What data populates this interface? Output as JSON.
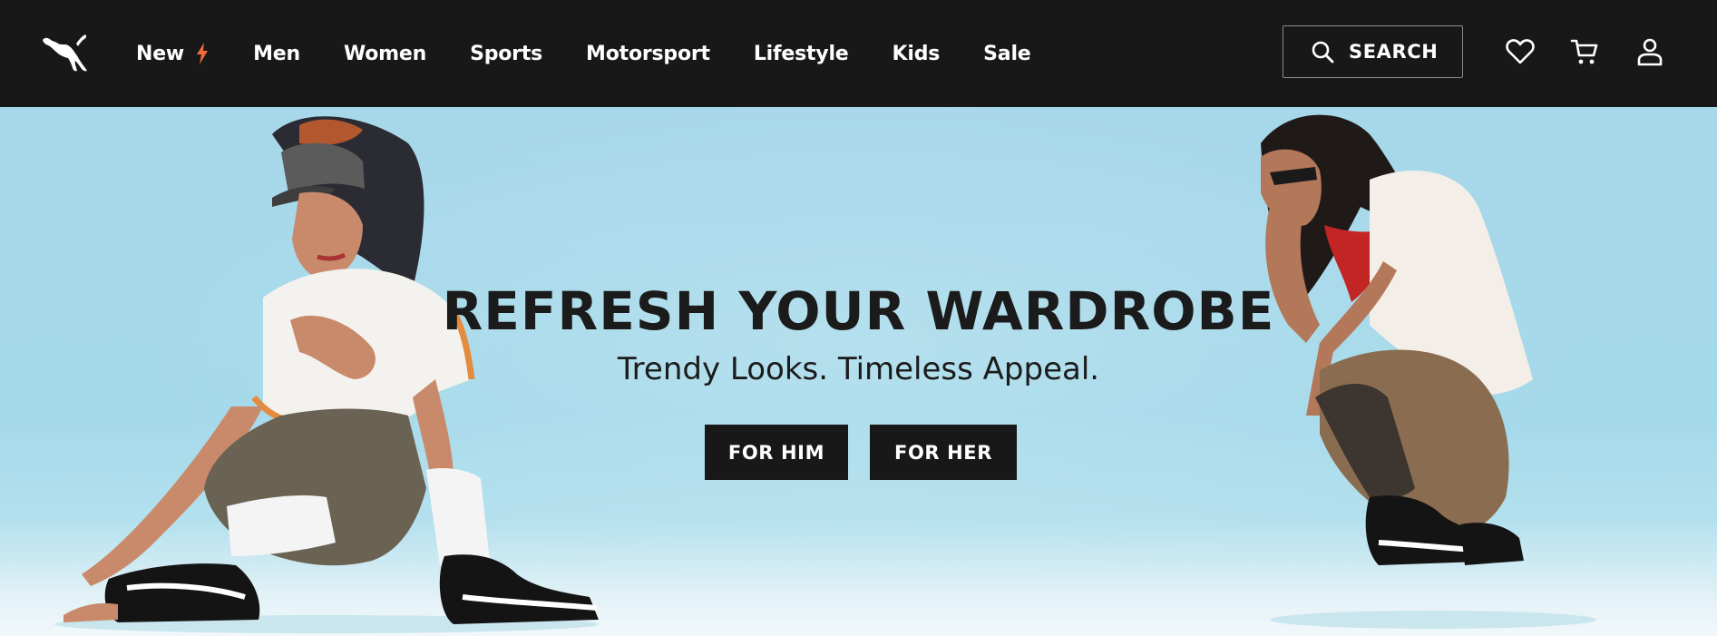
{
  "header": {
    "logo_icon": "puma-cat-logo",
    "nav": [
      {
        "label": "New",
        "icon": "lightning-bolt-icon",
        "accent": "#f26b3a"
      },
      {
        "label": "Men"
      },
      {
        "label": "Women"
      },
      {
        "label": "Sports"
      },
      {
        "label": "Motorsport"
      },
      {
        "label": "Lifestyle"
      },
      {
        "label": "Kids"
      },
      {
        "label": "Sale"
      }
    ],
    "search_label": "SEARCH",
    "icons": [
      "search-icon",
      "heart-icon",
      "cart-icon",
      "account-icon"
    ]
  },
  "hero": {
    "title": "REFRESH YOUR WARDROBE",
    "subtitle": "Trendy Looks. Timeless Appeal.",
    "cta_him": "FOR HIM",
    "cta_her": "FOR HER"
  },
  "colors": {
    "nav_bg": "#181818",
    "hero_bg": "#a6d8ea",
    "button_bg": "#181818",
    "accent": "#f26b3a"
  }
}
